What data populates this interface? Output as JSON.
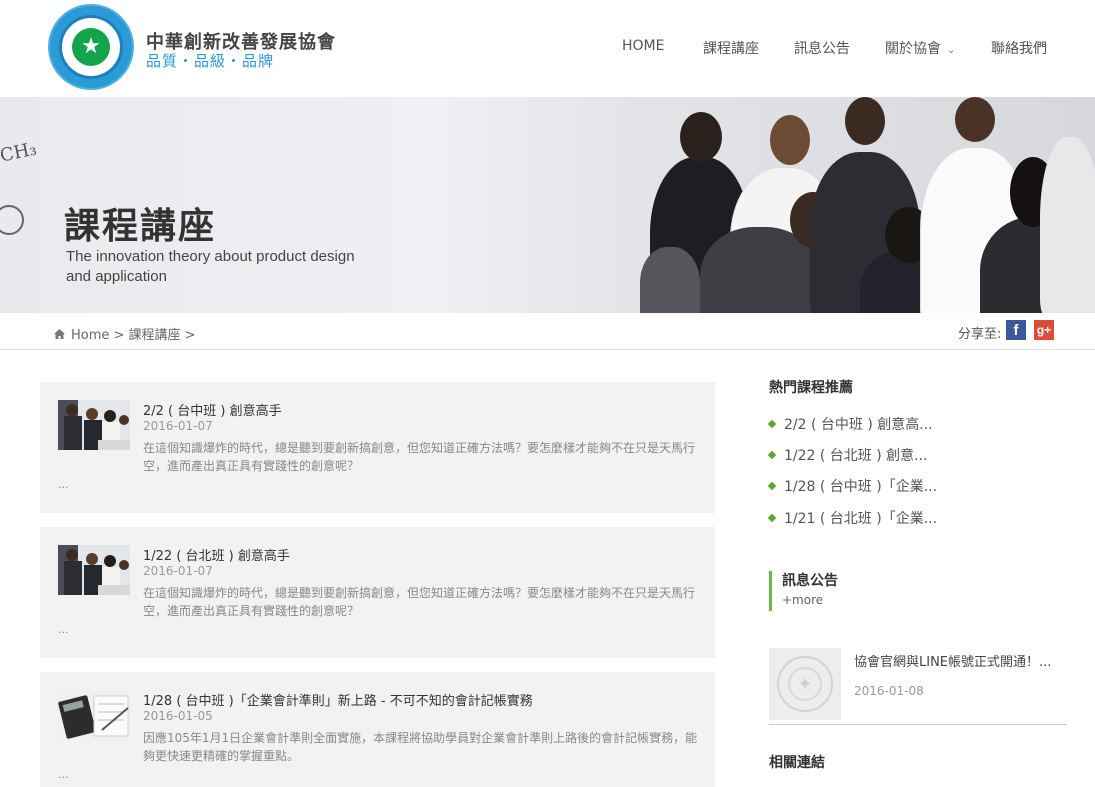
{
  "brand": {
    "name": "中華創新改善發展協會",
    "tagline": "品質・品級・品牌"
  },
  "nav": {
    "items": [
      {
        "label": "HOME"
      },
      {
        "label": "課程講座"
      },
      {
        "label": "訊息公告"
      },
      {
        "label": "關於協會",
        "has_dropdown": true
      },
      {
        "label": "聯絡我們"
      }
    ]
  },
  "banner": {
    "title": "課程講座",
    "subtitle": "The innovation theory about product design and application",
    "chem_text": "CH₃"
  },
  "breadcrumb": {
    "text": "Home > 課程講座 >"
  },
  "share": {
    "label": "分享至:",
    "facebook": "f",
    "google_plus": "g+"
  },
  "courses": [
    {
      "title": "2/2 ( 台中班 ) 創意高手",
      "date": "2016-01-07",
      "description": "在這個知識爆炸的時代，總是聽到要創新搞創意，但您知道正確方法嗎？要怎麼樣才能夠不在只是天馬行空，進而產出真正具有實踐性的創意呢？",
      "more": "..."
    },
    {
      "title": "1/22 ( 台北班 ) 創意高手",
      "date": "2016-01-07",
      "description": "在這個知識爆炸的時代，總是聽到要創新搞創意，但您知道正確方法嗎？要怎麼樣才能夠不在只是天馬行空，進而產出真正具有實踐性的創意呢？",
      "more": "..."
    },
    {
      "title": "1/28 ( 台中班 )「企業會計準則」新上路 - 不可不知的會計記帳實務",
      "date": "2016-01-05",
      "description": "因應105年1月1日企業會計準則全面實施，本課程將協助學員對企業會計準則上路後的會計記帳實務，能夠更快速更精確的掌握重點。",
      "more": "..."
    }
  ],
  "sidebar": {
    "hot_heading": "熱門課程推薦",
    "hot_items": [
      {
        "label": "2/2 ( 台中班 ) 創意高..."
      },
      {
        "label": "1/22 ( 台北班 ) 創意..."
      },
      {
        "label": "1/28 ( 台中班 )「企業..."
      },
      {
        "label": "1/21 ( 台北班 )「企業..."
      }
    ],
    "notice_heading": "訊息公告",
    "notice_more": "+more",
    "news": {
      "title": "協會官網與LINE帳號正式開通！...",
      "date": "2016-01-08"
    },
    "links_heading": "相關連結"
  }
}
